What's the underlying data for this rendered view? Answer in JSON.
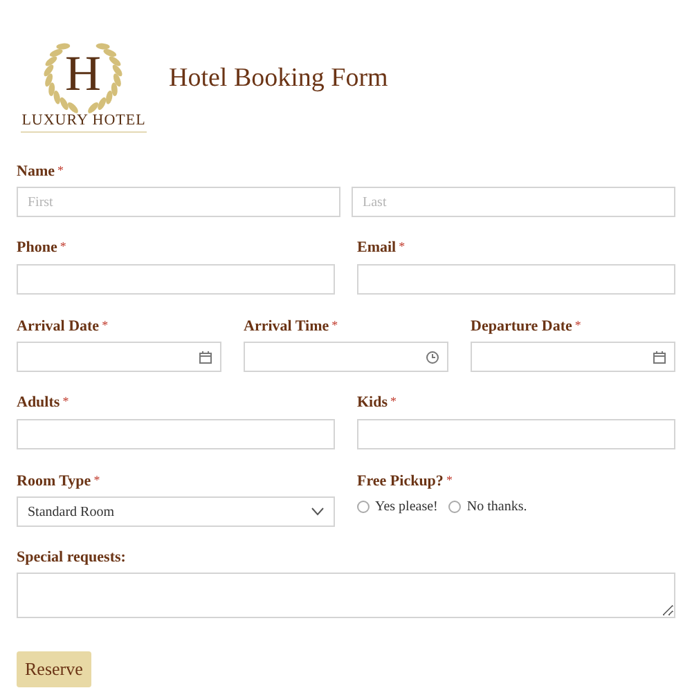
{
  "logo": {
    "initial": "H",
    "name": "LUXURY HOTEL"
  },
  "title": "Hotel Booking Form",
  "required_mark": "*",
  "rows": [
    {
      "fields": [
        {
          "kind": "name",
          "label": "Name",
          "required": true,
          "placeholders": [
            "First",
            "Last"
          ]
        }
      ]
    },
    {
      "fields": [
        {
          "kind": "text",
          "label": "Phone",
          "required": true
        },
        {
          "kind": "text",
          "label": "Email",
          "required": true
        }
      ]
    },
    {
      "fields": [
        {
          "kind": "date",
          "label": "Arrival Date",
          "required": true
        },
        {
          "kind": "time",
          "label": "Arrival Time",
          "required": true
        },
        {
          "kind": "date",
          "label": "Departure Date",
          "required": true
        }
      ]
    },
    {
      "fields": [
        {
          "kind": "text",
          "label": "Adults",
          "required": true
        },
        {
          "kind": "text",
          "label": "Kids",
          "required": true
        }
      ]
    },
    {
      "fields": [
        {
          "kind": "select",
          "label": "Room Type",
          "required": true,
          "value": "Standard Room"
        },
        {
          "kind": "radio",
          "label": "Free Pickup?",
          "required": true,
          "options": [
            {
              "label": "Yes please!",
              "selected": false
            },
            {
              "label": "No thanks.",
              "selected": false
            }
          ]
        }
      ]
    },
    {
      "fields": [
        {
          "kind": "textarea",
          "label": "Special requests:",
          "required": false
        }
      ]
    }
  ],
  "submit": "Reserve"
}
